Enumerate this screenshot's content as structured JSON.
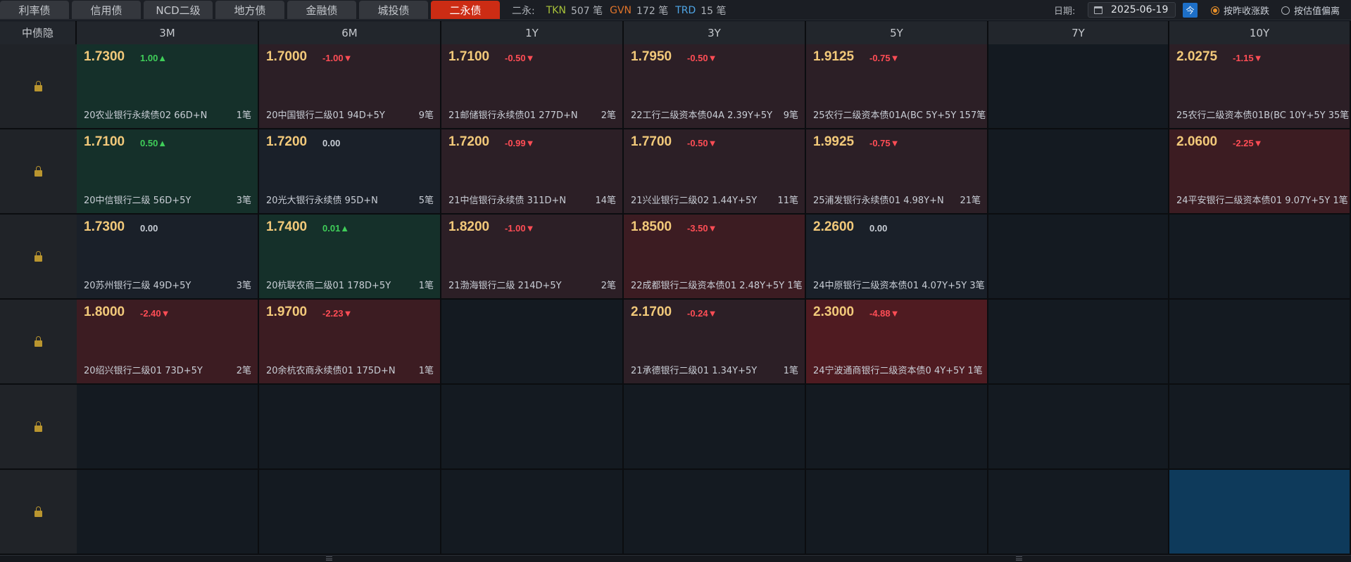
{
  "tabs": [
    {
      "label": "利率债",
      "active": false
    },
    {
      "label": "信用债",
      "active": false
    },
    {
      "label": "NCD二级",
      "active": false
    },
    {
      "label": "地方债",
      "active": false
    },
    {
      "label": "金融债",
      "active": false
    },
    {
      "label": "城投债",
      "active": false
    },
    {
      "label": "二永债",
      "active": true
    }
  ],
  "stats": {
    "label": "二永:",
    "tkn_label": "TKN",
    "tkn_value": "507 笔",
    "gvn_label": "GVN",
    "gvn_value": "172 笔",
    "trd_label": "TRD",
    "trd_value": "15 笔"
  },
  "date": {
    "label": "日期:",
    "value": "2025-06-19",
    "today_label": "今"
  },
  "options": [
    {
      "label": "按昨收涨跌",
      "selected": true
    },
    {
      "label": "按估值偏离",
      "selected": false
    }
  ],
  "grid": {
    "corner_label": "中债隐",
    "columns": [
      "3M",
      "6M",
      "1Y",
      "3Y",
      "5Y",
      "7Y",
      "10Y"
    ],
    "lock_icon": "lock-icon",
    "rows": [
      [
        {
          "yield": "1.7300",
          "change": "1.00▲",
          "dir": "up",
          "bond": "20农业银行永续债02 66D+N",
          "count": "1笔"
        },
        {
          "yield": "1.7000",
          "change": "-1.00▼",
          "dir": "down",
          "bond": "20中国银行二级01 94D+5Y",
          "count": "9笔"
        },
        {
          "yield": "1.7100",
          "change": "-0.50▼",
          "dir": "down",
          "bond": "21邮储银行永续债01 277D+N",
          "count": "2笔"
        },
        {
          "yield": "1.7950",
          "change": "-0.50▼",
          "dir": "down",
          "bond": "22工行二级资本债04A 2.39Y+5Y",
          "count": "9笔"
        },
        {
          "yield": "1.9125",
          "change": "-0.75▼",
          "dir": "down",
          "bond": "25农行二级资本债01A(BC 5Y+5Y 157笔",
          "count": ""
        },
        null,
        {
          "yield": "2.0275",
          "change": "-1.15▼",
          "dir": "down",
          "bond": "25农行二级资本债01B(BC 10Y+5Y 35笔",
          "count": ""
        }
      ],
      [
        {
          "yield": "1.7100",
          "change": "0.50▲",
          "dir": "up",
          "bond": "20中信银行二级 56D+5Y",
          "count": "3笔"
        },
        {
          "yield": "1.7200",
          "change": "0.00",
          "dir": "flat",
          "bond": "20光大银行永续债 95D+N",
          "count": "5笔"
        },
        {
          "yield": "1.7200",
          "change": "-0.99▼",
          "dir": "down",
          "bond": "21中信银行永续债 311D+N",
          "count": "14笔"
        },
        {
          "yield": "1.7700",
          "change": "-0.50▼",
          "dir": "down",
          "bond": "21兴业银行二级02 1.44Y+5Y",
          "count": "11笔"
        },
        {
          "yield": "1.9925",
          "change": "-0.75▼",
          "dir": "down",
          "bond": "25浦发银行永续债01 4.98Y+N",
          "count": "21笔"
        },
        null,
        {
          "yield": "2.0600",
          "change": "-2.25▼",
          "dir": "down2",
          "bond": "24平安银行二级资本债01 9.07Y+5Y 1笔",
          "count": ""
        }
      ],
      [
        {
          "yield": "1.7300",
          "change": "0.00",
          "dir": "flat",
          "bond": "20苏州银行二级 49D+5Y",
          "count": "3笔"
        },
        {
          "yield": "1.7400",
          "change": "0.01▲",
          "dir": "up",
          "bond": "20杭联农商二级01 178D+5Y",
          "count": "1笔"
        },
        {
          "yield": "1.8200",
          "change": "-1.00▼",
          "dir": "down",
          "bond": "21渤海银行二级 214D+5Y",
          "count": "2笔"
        },
        {
          "yield": "1.8500",
          "change": "-3.50▼",
          "dir": "down2",
          "bond": "22成都银行二级资本债01 2.48Y+5Y 1笔",
          "count": ""
        },
        {
          "yield": "2.2600",
          "change": "0.00",
          "dir": "flat",
          "bond": "24中原银行二级资本债01 4.07Y+5Y 3笔",
          "count": ""
        },
        null,
        null
      ],
      [
        {
          "yield": "1.8000",
          "change": "-2.40▼",
          "dir": "down2",
          "bond": "20绍兴银行二级01 73D+5Y",
          "count": "2笔"
        },
        {
          "yield": "1.9700",
          "change": "-2.23▼",
          "dir": "down2",
          "bond": "20余杭农商永续债01 175D+N",
          "count": "1笔"
        },
        null,
        {
          "yield": "2.1700",
          "change": "-0.24▼",
          "dir": "down",
          "bond": "21承德银行二级01 1.34Y+5Y",
          "count": "1笔"
        },
        {
          "yield": "2.3000",
          "change": "-4.88▼",
          "dir": "down3",
          "bond": "24宁波通商银行二级资本债0 4Y+5Y 1笔",
          "count": ""
        },
        null,
        null
      ],
      [
        null,
        null,
        null,
        null,
        null,
        null,
        null
      ],
      [
        null,
        null,
        null,
        null,
        null,
        null,
        "blue"
      ]
    ]
  },
  "colors": {
    "active_tab": "#cc2c14",
    "yield_text": "#f2c97a",
    "up": "#3fce59",
    "down": "#ff4d55",
    "tkn": "#a8c23a",
    "gvn": "#e0742a",
    "trd": "#4fa6e6"
  }
}
